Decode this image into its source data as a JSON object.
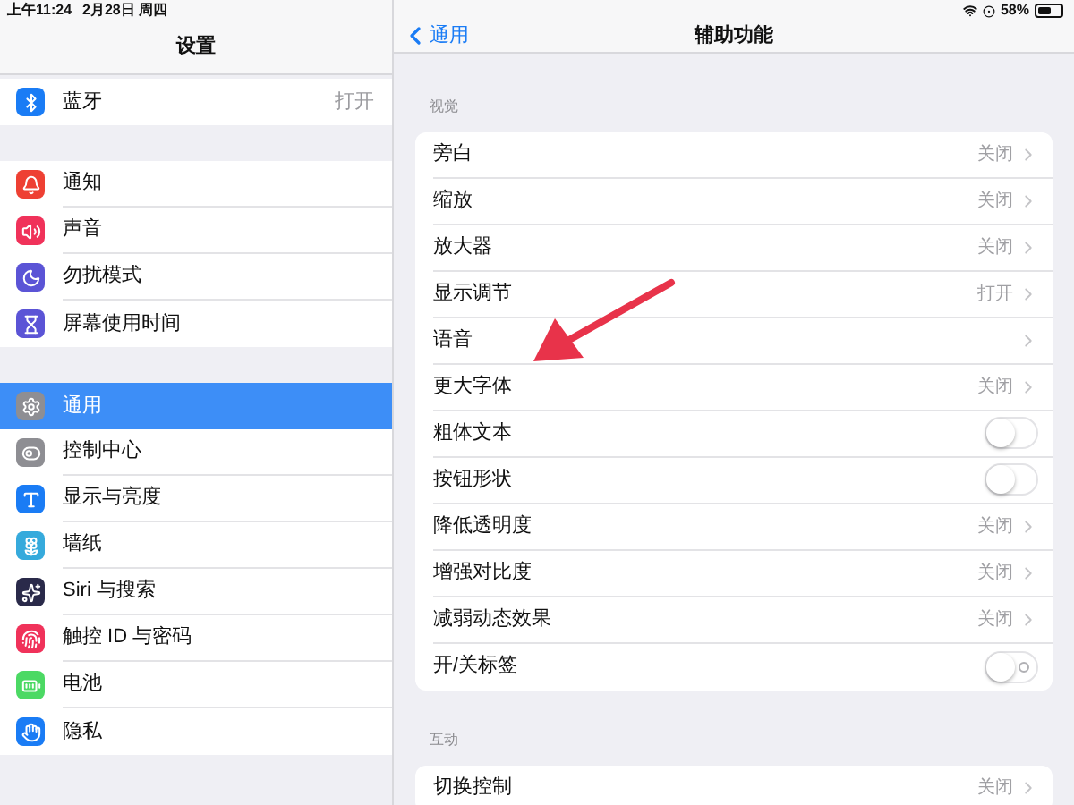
{
  "status_bar": {
    "time": "上午11:24",
    "date": "2月28日 周四",
    "battery": "58%"
  },
  "sidebar": {
    "title": "设置",
    "groups": [
      [
        {
          "label": "蓝牙",
          "value": "打开",
          "kind": "bluetooth",
          "color": "#1a7cf5",
          "selected": false
        }
      ],
      [
        {
          "label": "通知",
          "kind": "bell",
          "color": "#ee4033",
          "selected": false
        },
        {
          "label": "声音",
          "kind": "sound",
          "color": "#f0325a",
          "selected": false
        },
        {
          "label": "勿扰模式",
          "kind": "moon",
          "color": "#5b54d6",
          "selected": false
        },
        {
          "label": "屏幕使用时间",
          "kind": "hourglass",
          "color": "#5b54d6",
          "selected": false
        }
      ],
      [
        {
          "label": "通用",
          "kind": "gear",
          "color": "#8e8e93",
          "selected": true
        },
        {
          "label": "控制中心",
          "kind": "toggles",
          "color": "#8e8e93",
          "selected": false
        },
        {
          "label": "显示与亮度",
          "kind": "type",
          "color": "#1a7cf5",
          "selected": false
        },
        {
          "label": "墙纸",
          "kind": "flower",
          "color": "#36aadc",
          "selected": false
        },
        {
          "label": "Siri 与搜索",
          "kind": "siri",
          "color": "#2a2a4a",
          "selected": false
        },
        {
          "label": "触控 ID 与密码",
          "kind": "fingerprint",
          "color": "#f0325a",
          "selected": false
        },
        {
          "label": "电池",
          "kind": "battery",
          "color": "#4cd964",
          "selected": false
        },
        {
          "label": "隐私",
          "kind": "hand",
          "color": "#1a7cf5",
          "selected": false
        }
      ]
    ]
  },
  "detail": {
    "back": "通用",
    "title": "辅助功能",
    "sections": [
      {
        "header": "视觉",
        "rows": [
          {
            "label": "旁白",
            "kind": "value",
            "value": "关闭"
          },
          {
            "label": "缩放",
            "kind": "value",
            "value": "关闭"
          },
          {
            "label": "放大器",
            "kind": "value",
            "value": "关闭"
          },
          {
            "label": "显示调节",
            "kind": "value",
            "value": "打开"
          },
          {
            "label": "语音",
            "kind": "link"
          },
          {
            "label": "更大字体",
            "kind": "value",
            "value": "关闭"
          },
          {
            "label": "粗体文本",
            "kind": "switch",
            "on": false
          },
          {
            "label": "按钮形状",
            "kind": "switch",
            "on": false
          },
          {
            "label": "降低透明度",
            "kind": "value",
            "value": "关闭"
          },
          {
            "label": "增强对比度",
            "kind": "value",
            "value": "关闭"
          },
          {
            "label": "减弱动态效果",
            "kind": "value",
            "value": "关闭"
          },
          {
            "label": "开/关标签",
            "kind": "switch",
            "on": false,
            "label_mark": true
          }
        ]
      },
      {
        "header": "互动",
        "rows": [
          {
            "label": "切换控制",
            "kind": "value",
            "value": "关闭"
          }
        ]
      }
    ]
  }
}
